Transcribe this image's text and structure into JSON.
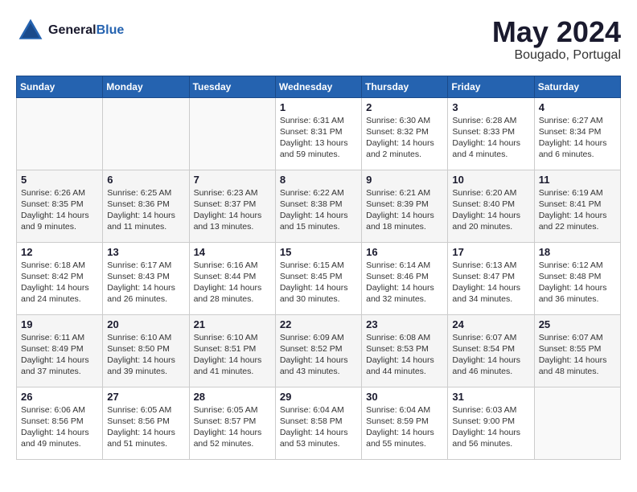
{
  "header": {
    "logo_line1": "General",
    "logo_line2": "Blue",
    "month": "May 2024",
    "location": "Bougado, Portugal"
  },
  "days_of_week": [
    "Sunday",
    "Monday",
    "Tuesday",
    "Wednesday",
    "Thursday",
    "Friday",
    "Saturday"
  ],
  "weeks": [
    [
      {
        "day": "",
        "info": ""
      },
      {
        "day": "",
        "info": ""
      },
      {
        "day": "",
        "info": ""
      },
      {
        "day": "1",
        "info": "Sunrise: 6:31 AM\nSunset: 8:31 PM\nDaylight: 13 hours\nand 59 minutes."
      },
      {
        "day": "2",
        "info": "Sunrise: 6:30 AM\nSunset: 8:32 PM\nDaylight: 14 hours\nand 2 minutes."
      },
      {
        "day": "3",
        "info": "Sunrise: 6:28 AM\nSunset: 8:33 PM\nDaylight: 14 hours\nand 4 minutes."
      },
      {
        "day": "4",
        "info": "Sunrise: 6:27 AM\nSunset: 8:34 PM\nDaylight: 14 hours\nand 6 minutes."
      }
    ],
    [
      {
        "day": "5",
        "info": "Sunrise: 6:26 AM\nSunset: 8:35 PM\nDaylight: 14 hours\nand 9 minutes."
      },
      {
        "day": "6",
        "info": "Sunrise: 6:25 AM\nSunset: 8:36 PM\nDaylight: 14 hours\nand 11 minutes."
      },
      {
        "day": "7",
        "info": "Sunrise: 6:23 AM\nSunset: 8:37 PM\nDaylight: 14 hours\nand 13 minutes."
      },
      {
        "day": "8",
        "info": "Sunrise: 6:22 AM\nSunset: 8:38 PM\nDaylight: 14 hours\nand 15 minutes."
      },
      {
        "day": "9",
        "info": "Sunrise: 6:21 AM\nSunset: 8:39 PM\nDaylight: 14 hours\nand 18 minutes."
      },
      {
        "day": "10",
        "info": "Sunrise: 6:20 AM\nSunset: 8:40 PM\nDaylight: 14 hours\nand 20 minutes."
      },
      {
        "day": "11",
        "info": "Sunrise: 6:19 AM\nSunset: 8:41 PM\nDaylight: 14 hours\nand 22 minutes."
      }
    ],
    [
      {
        "day": "12",
        "info": "Sunrise: 6:18 AM\nSunset: 8:42 PM\nDaylight: 14 hours\nand 24 minutes."
      },
      {
        "day": "13",
        "info": "Sunrise: 6:17 AM\nSunset: 8:43 PM\nDaylight: 14 hours\nand 26 minutes."
      },
      {
        "day": "14",
        "info": "Sunrise: 6:16 AM\nSunset: 8:44 PM\nDaylight: 14 hours\nand 28 minutes."
      },
      {
        "day": "15",
        "info": "Sunrise: 6:15 AM\nSunset: 8:45 PM\nDaylight: 14 hours\nand 30 minutes."
      },
      {
        "day": "16",
        "info": "Sunrise: 6:14 AM\nSunset: 8:46 PM\nDaylight: 14 hours\nand 32 minutes."
      },
      {
        "day": "17",
        "info": "Sunrise: 6:13 AM\nSunset: 8:47 PM\nDaylight: 14 hours\nand 34 minutes."
      },
      {
        "day": "18",
        "info": "Sunrise: 6:12 AM\nSunset: 8:48 PM\nDaylight: 14 hours\nand 36 minutes."
      }
    ],
    [
      {
        "day": "19",
        "info": "Sunrise: 6:11 AM\nSunset: 8:49 PM\nDaylight: 14 hours\nand 37 minutes."
      },
      {
        "day": "20",
        "info": "Sunrise: 6:10 AM\nSunset: 8:50 PM\nDaylight: 14 hours\nand 39 minutes."
      },
      {
        "day": "21",
        "info": "Sunrise: 6:10 AM\nSunset: 8:51 PM\nDaylight: 14 hours\nand 41 minutes."
      },
      {
        "day": "22",
        "info": "Sunrise: 6:09 AM\nSunset: 8:52 PM\nDaylight: 14 hours\nand 43 minutes."
      },
      {
        "day": "23",
        "info": "Sunrise: 6:08 AM\nSunset: 8:53 PM\nDaylight: 14 hours\nand 44 minutes."
      },
      {
        "day": "24",
        "info": "Sunrise: 6:07 AM\nSunset: 8:54 PM\nDaylight: 14 hours\nand 46 minutes."
      },
      {
        "day": "25",
        "info": "Sunrise: 6:07 AM\nSunset: 8:55 PM\nDaylight: 14 hours\nand 48 minutes."
      }
    ],
    [
      {
        "day": "26",
        "info": "Sunrise: 6:06 AM\nSunset: 8:56 PM\nDaylight: 14 hours\nand 49 minutes."
      },
      {
        "day": "27",
        "info": "Sunrise: 6:05 AM\nSunset: 8:56 PM\nDaylight: 14 hours\nand 51 minutes."
      },
      {
        "day": "28",
        "info": "Sunrise: 6:05 AM\nSunset: 8:57 PM\nDaylight: 14 hours\nand 52 minutes."
      },
      {
        "day": "29",
        "info": "Sunrise: 6:04 AM\nSunset: 8:58 PM\nDaylight: 14 hours\nand 53 minutes."
      },
      {
        "day": "30",
        "info": "Sunrise: 6:04 AM\nSunset: 8:59 PM\nDaylight: 14 hours\nand 55 minutes."
      },
      {
        "day": "31",
        "info": "Sunrise: 6:03 AM\nSunset: 9:00 PM\nDaylight: 14 hours\nand 56 minutes."
      },
      {
        "day": "",
        "info": ""
      }
    ]
  ]
}
